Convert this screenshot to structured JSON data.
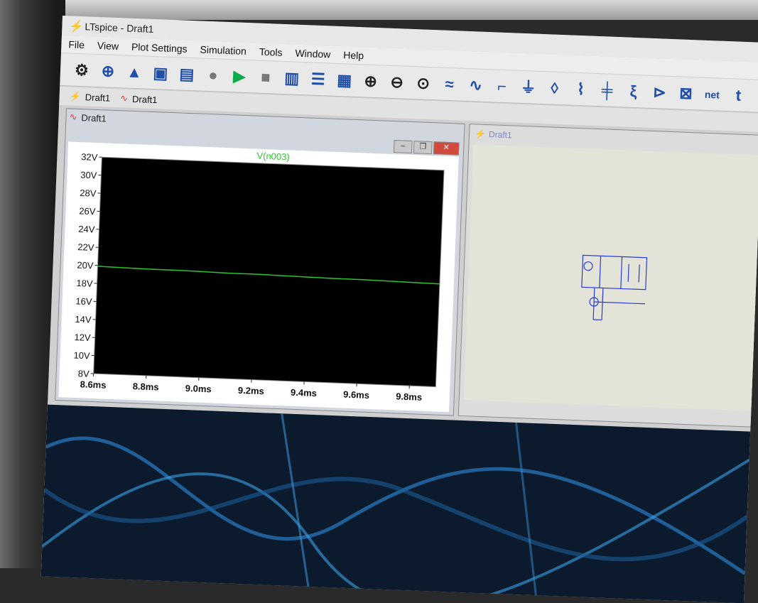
{
  "window": {
    "title": "LTspice - Draft1",
    "logo_icon": "ltspice-logo-icon"
  },
  "menu": [
    "File",
    "View",
    "Plot Settings",
    "Simulation",
    "Tools",
    "Window",
    "Help"
  ],
  "toolbar": {
    "icons": [
      "gear-icon",
      "new-schematic-icon",
      "open-icon",
      "save-icon",
      "print-icon",
      "halt-icon",
      "run-icon",
      "stop-icon",
      "tile-vertical-icon",
      "tile-horizontal-icon",
      "cascade-icon",
      "zoom-in-icon",
      "zoom-out-icon",
      "zoom-fit-icon",
      "autorange-icon",
      "waveform-icon",
      "wire-icon",
      "ground-icon",
      "label-icon",
      "resistor-icon",
      "capacitor-icon",
      "inductor-icon",
      "diode-icon",
      "component-icon",
      "netlist-icon",
      "text-icon"
    ],
    "netlist_label": "net",
    "text_label": "t"
  },
  "tabs": [
    {
      "label": "Draft1",
      "icon": "schematic-icon"
    },
    {
      "label": "Draft1",
      "icon": "waveform-icon"
    }
  ],
  "plot_window": {
    "title": "Draft1",
    "buttons": [
      "minimize-icon",
      "restore-icon",
      "close-icon"
    ]
  },
  "schematic_window": {
    "title": "Draft1"
  },
  "chart_data": {
    "type": "line",
    "title": "V(n003)",
    "xlabel": "",
    "ylabel": "",
    "xlim": [
      8.6,
      9.9
    ],
    "ylim": [
      8,
      32
    ],
    "x_ticks": [
      "8.6ms",
      "8.8ms",
      "9.0ms",
      "9.2ms",
      "9.4ms",
      "9.6ms",
      "9.8ms"
    ],
    "y_ticks": [
      "32V",
      "30V",
      "28V",
      "26V",
      "24V",
      "22V",
      "20V",
      "18V",
      "16V",
      "14V",
      "12V",
      "10V",
      "8V"
    ],
    "series": [
      {
        "name": "V(n003)",
        "color": "#2ec32e",
        "x": [
          8.6,
          8.7,
          8.8,
          8.9,
          9.0,
          9.1,
          9.2,
          9.3,
          9.4,
          9.5,
          9.6,
          9.7,
          9.8,
          9.9
        ],
        "y": [
          19.9,
          19.85,
          19.8,
          19.8,
          19.75,
          19.7,
          19.7,
          19.65,
          19.6,
          19.55,
          19.55,
          19.5,
          19.45,
          19.4
        ]
      }
    ],
    "grid": false
  }
}
